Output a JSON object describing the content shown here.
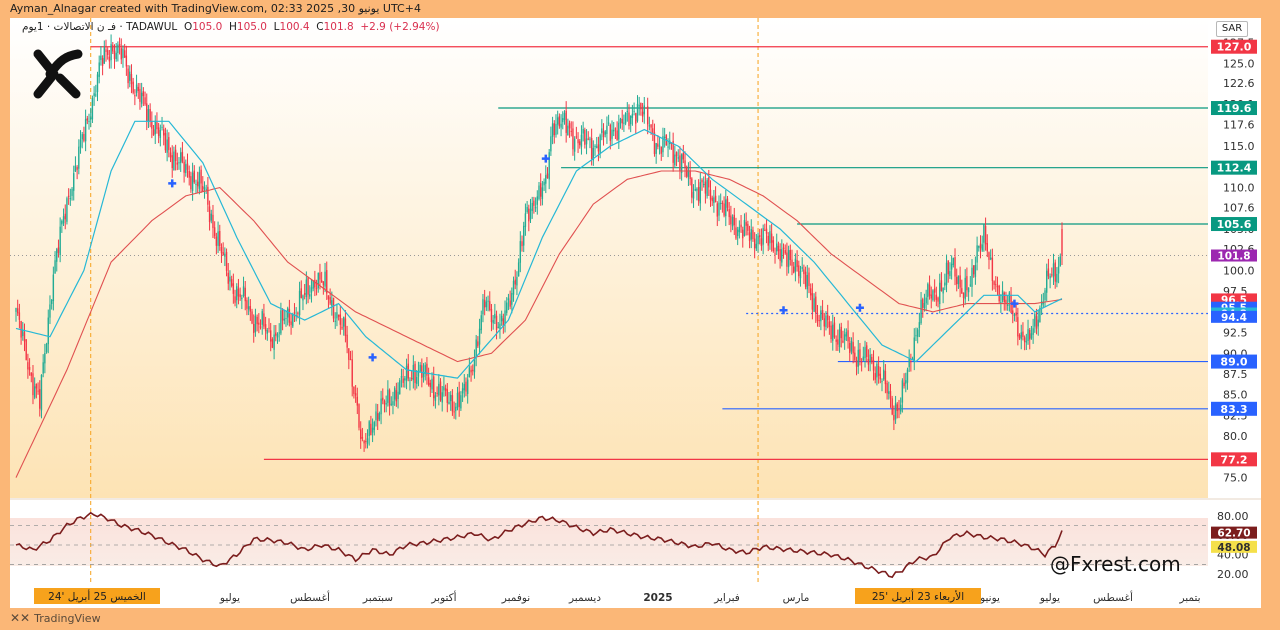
{
  "header": {
    "credit": "Ayman_Alnagar created with TradingView.com, 02:33 2025 ,30 يونيو UTC+4",
    "symbol_name": "فـ ن الاتصالات · 1يوم · TADAWUL",
    "open_label": "O",
    "open": "105.0",
    "high_label": "H",
    "high": "105.0",
    "low_label": "L",
    "low": "100.4",
    "close_label": "C",
    "close": "101.8",
    "change": "+2.9 (+2.94%)",
    "currency": "SAR"
  },
  "footer": {
    "brand": "TradingView",
    "brand_icon": "tradingview-logo-icon"
  },
  "watermark": {
    "handle": "@Fxrest.com",
    "logo_icon": "x-brand-logo-icon"
  },
  "colors": {
    "up": "#22ab94",
    "down": "#f23645",
    "ma_fast": "#26b8d6",
    "ma_slow": "#e05050",
    "green_level": "#089981",
    "red_level": "#f23645",
    "blue_level": "#2962ff",
    "highlight": "#f7a21c",
    "rsi": "#7b1d1d"
  },
  "chart_data": {
    "type": "candlestick",
    "y_axis_labels": [
      "127.5",
      "125.0",
      "122.6",
      "120.1",
      "117.6",
      "115.0",
      "112.5",
      "110.0",
      "107.6",
      "105.0",
      "102.6",
      "100.0",
      "97.5",
      "95.0",
      "92.5",
      "90.0",
      "87.5",
      "85.0",
      "82.5",
      "80.0",
      "77.5",
      "75.0"
    ],
    "ylim": [
      73.5,
      129.5
    ],
    "x_axis_labels": [
      "يوليو",
      "أغسطس",
      "سبتمبر",
      "أكتوبر",
      "نوفمبر",
      "ديسمبر",
      "2025",
      "فبراير",
      "مارس",
      "يونيو",
      "يوليو",
      "أغسطس",
      "بتمبر"
    ],
    "time_markers": [
      {
        "label": "الخميس 25 أبريل '24",
        "position": "start"
      },
      {
        "label": "الأربعاء 23 أبريل '25",
        "position": "recent"
      }
    ],
    "horizontal_levels": [
      {
        "value": 127.0,
        "label": "127.0",
        "color": "red"
      },
      {
        "value": 119.6,
        "label": "119.6",
        "color": "green"
      },
      {
        "value": 112.4,
        "label": "112.4",
        "color": "green"
      },
      {
        "value": 105.6,
        "label": "105.6",
        "color": "green"
      },
      {
        "value": 89.0,
        "label": "89.0",
        "color": "blue"
      },
      {
        "value": 83.3,
        "label": "83.3",
        "color": "blue"
      },
      {
        "value": 77.2,
        "label": "77.2",
        "color": "red"
      }
    ],
    "price_tags": [
      {
        "value": 101.8,
        "label": "101.8",
        "color": "#9c27b0"
      },
      {
        "value": 96.5,
        "label": "96.5",
        "color": "#f23645"
      },
      {
        "value": 95.5,
        "label": "95.5",
        "color": "#2962ff"
      },
      {
        "value": 94.8,
        "label": "94.8",
        "color": "#26b8d6"
      },
      {
        "value": 94.4,
        "label": "94.4",
        "color": "#2962ff"
      }
    ],
    "dotted_level": 94.8,
    "price_path": [
      [
        0,
        95
      ],
      [
        8,
        88
      ],
      [
        14,
        84
      ],
      [
        22,
        100
      ],
      [
        32,
        110
      ],
      [
        42,
        118
      ],
      [
        50,
        125
      ],
      [
        56,
        127
      ],
      [
        62,
        126
      ],
      [
        70,
        122
      ],
      [
        80,
        118
      ],
      [
        92,
        114
      ],
      [
        100,
        112
      ],
      [
        106,
        111
      ],
      [
        112,
        109
      ],
      [
        118,
        104
      ],
      [
        124,
        100
      ],
      [
        130,
        97
      ],
      [
        136,
        96
      ],
      [
        140,
        94
      ],
      [
        146,
        93
      ],
      [
        152,
        92
      ],
      [
        158,
        94
      ],
      [
        164,
        95
      ],
      [
        170,
        97
      ],
      [
        176,
        99
      ],
      [
        182,
        98
      ],
      [
        188,
        95
      ],
      [
        194,
        92
      ],
      [
        200,
        85
      ],
      [
        204,
        78
      ],
      [
        210,
        82
      ],
      [
        218,
        84
      ],
      [
        226,
        86
      ],
      [
        234,
        88
      ],
      [
        242,
        87
      ],
      [
        250,
        85
      ],
      [
        258,
        84
      ],
      [
        264,
        85
      ],
      [
        270,
        90
      ],
      [
        276,
        96
      ],
      [
        280,
        95
      ],
      [
        286,
        93
      ],
      [
        290,
        96
      ],
      [
        296,
        101
      ],
      [
        300,
        106
      ],
      [
        306,
        109
      ],
      [
        312,
        110
      ],
      [
        316,
        118
      ],
      [
        320,
        118
      ],
      [
        330,
        116
      ],
      [
        340,
        115
      ],
      [
        350,
        117
      ],
      [
        360,
        118
      ],
      [
        366,
        120
      ],
      [
        372,
        118
      ],
      [
        378,
        115
      ],
      [
        386,
        115
      ],
      [
        392,
        113
      ],
      [
        398,
        110
      ],
      [
        404,
        110
      ],
      [
        410,
        109
      ],
      [
        418,
        107
      ],
      [
        426,
        105
      ],
      [
        434,
        104
      ],
      [
        440,
        104
      ],
      [
        448,
        103
      ],
      [
        454,
        101
      ],
      [
        460,
        101
      ],
      [
        466,
        98
      ],
      [
        472,
        95
      ],
      [
        478,
        93
      ],
      [
        486,
        92
      ],
      [
        494,
        90
      ],
      [
        502,
        89
      ],
      [
        508,
        88
      ],
      [
        512,
        86
      ],
      [
        516,
        83
      ],
      [
        520,
        84
      ],
      [
        526,
        88
      ],
      [
        532,
        95
      ],
      [
        538,
        97
      ],
      [
        546,
        98
      ],
      [
        552,
        101
      ],
      [
        558,
        97
      ],
      [
        562,
        98
      ],
      [
        566,
        103
      ],
      [
        570,
        104
      ],
      [
        574,
        100
      ],
      [
        578,
        98
      ],
      [
        582,
        96
      ],
      [
        588,
        95
      ],
      [
        592,
        92
      ],
      [
        596,
        91
      ],
      [
        600,
        94
      ],
      [
        604,
        96
      ],
      [
        608,
        99
      ],
      [
        612,
        100
      ],
      [
        616,
        101.8
      ]
    ],
    "ma_fast_path": [
      [
        0,
        93
      ],
      [
        20,
        92
      ],
      [
        40,
        100
      ],
      [
        56,
        112
      ],
      [
        70,
        118
      ],
      [
        90,
        118
      ],
      [
        110,
        113
      ],
      [
        130,
        104
      ],
      [
        150,
        96
      ],
      [
        170,
        94
      ],
      [
        190,
        96
      ],
      [
        206,
        92
      ],
      [
        230,
        88
      ],
      [
        260,
        87
      ],
      [
        290,
        94
      ],
      [
        310,
        104
      ],
      [
        330,
        112
      ],
      [
        350,
        115
      ],
      [
        370,
        117
      ],
      [
        390,
        115
      ],
      [
        410,
        111
      ],
      [
        430,
        108
      ],
      [
        450,
        105
      ],
      [
        470,
        101
      ],
      [
        490,
        96
      ],
      [
        510,
        91
      ],
      [
        530,
        89
      ],
      [
        550,
        93
      ],
      [
        570,
        97
      ],
      [
        590,
        97
      ],
      [
        600,
        95
      ],
      [
        616,
        96.6
      ]
    ],
    "ma_slow_path": [
      [
        0,
        75
      ],
      [
        30,
        88
      ],
      [
        56,
        101
      ],
      [
        80,
        106
      ],
      [
        100,
        109
      ],
      [
        120,
        110
      ],
      [
        140,
        106
      ],
      [
        160,
        101
      ],
      [
        180,
        98
      ],
      [
        200,
        95
      ],
      [
        230,
        92
      ],
      [
        260,
        89
      ],
      [
        280,
        90
      ],
      [
        300,
        94
      ],
      [
        320,
        102
      ],
      [
        340,
        108
      ],
      [
        360,
        111
      ],
      [
        380,
        112
      ],
      [
        400,
        112
      ],
      [
        420,
        111
      ],
      [
        440,
        109
      ],
      [
        460,
        106
      ],
      [
        480,
        102
      ],
      [
        500,
        99
      ],
      [
        520,
        96
      ],
      [
        540,
        95
      ],
      [
        560,
        96
      ],
      [
        580,
        96
      ],
      [
        600,
        96
      ],
      [
        616,
        96.5
      ]
    ],
    "rsi": {
      "y_axis_labels": [
        "80.00",
        "60.00",
        "40.00",
        "20.00"
      ],
      "ylim": [
        14,
        88
      ],
      "levels": [
        70,
        50,
        30
      ],
      "last": "62.70",
      "signal": "48.08",
      "path": [
        [
          0,
          50
        ],
        [
          10,
          45
        ],
        [
          20,
          55
        ],
        [
          30,
          70
        ],
        [
          38,
          78
        ],
        [
          46,
          82
        ],
        [
          54,
          77
        ],
        [
          62,
          70
        ],
        [
          70,
          66
        ],
        [
          80,
          60
        ],
        [
          90,
          52
        ],
        [
          100,
          45
        ],
        [
          110,
          35
        ],
        [
          120,
          28
        ],
        [
          130,
          40
        ],
        [
          140,
          56
        ],
        [
          150,
          55
        ],
        [
          160,
          52
        ],
        [
          170,
          45
        ],
        [
          180,
          50
        ],
        [
          190,
          45
        ],
        [
          200,
          35
        ],
        [
          210,
          45
        ],
        [
          220,
          40
        ],
        [
          230,
          50
        ],
        [
          240,
          52
        ],
        [
          250,
          55
        ],
        [
          260,
          58
        ],
        [
          270,
          62
        ],
        [
          280,
          55
        ],
        [
          290,
          65
        ],
        [
          300,
          72
        ],
        [
          310,
          78
        ],
        [
          320,
          75
        ],
        [
          330,
          68
        ],
        [
          340,
          62
        ],
        [
          350,
          66
        ],
        [
          360,
          62
        ],
        [
          370,
          58
        ],
        [
          380,
          56
        ],
        [
          390,
          52
        ],
        [
          400,
          48
        ],
        [
          410,
          52
        ],
        [
          420,
          45
        ],
        [
          430,
          42
        ],
        [
          440,
          48
        ],
        [
          450,
          46
        ],
        [
          460,
          44
        ],
        [
          470,
          42
        ],
        [
          480,
          40
        ],
        [
          490,
          35
        ],
        [
          500,
          28
        ],
        [
          510,
          22
        ],
        [
          516,
          18
        ],
        [
          520,
          22
        ],
        [
          530,
          35
        ],
        [
          540,
          38
        ],
        [
          550,
          58
        ],
        [
          560,
          62
        ],
        [
          570,
          58
        ],
        [
          580,
          56
        ],
        [
          590,
          52
        ],
        [
          600,
          46
        ],
        [
          606,
          40
        ],
        [
          612,
          50
        ],
        [
          616,
          62.7
        ]
      ]
    }
  }
}
